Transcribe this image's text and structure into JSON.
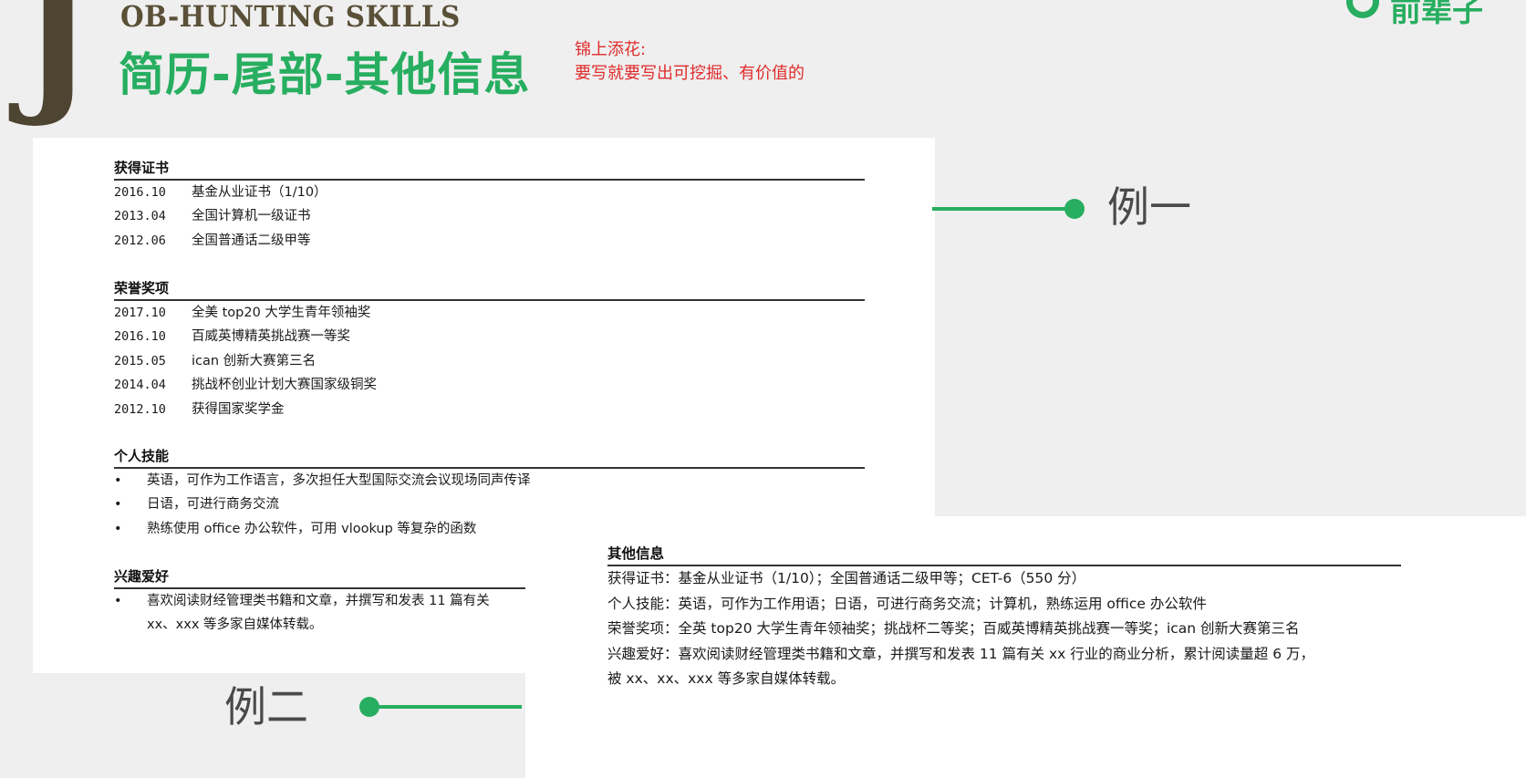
{
  "header": {
    "big_letter": "J",
    "subtitle_en": "OB-HUNTING SKILLS",
    "title_cn": "简历-尾部-其他信息",
    "logo_text": "前辈子"
  },
  "note": {
    "line1": "锦上添花:",
    "line2": "要写就要写出可挖掘、有价值的"
  },
  "example1": {
    "label": "例一",
    "sections": {
      "certs": {
        "title": "获得证书",
        "rows": [
          {
            "date": "2016.10",
            "text": "基金从业证书（1/10）"
          },
          {
            "date": "2013.04",
            "text": "全国计算机一级证书"
          },
          {
            "date": "2012.06",
            "text": "全国普通话二级甲等"
          }
        ]
      },
      "honors": {
        "title": "荣誉奖项",
        "rows": [
          {
            "date": "2017.10",
            "text": "全美 top20 大学生青年领袖奖"
          },
          {
            "date": "2016.10",
            "text": "百威英博精英挑战赛一等奖"
          },
          {
            "date": "2015.05",
            "text": "ican 创新大赛第三名"
          },
          {
            "date": "2014.04",
            "text": "挑战杯创业计划大赛国家级铜奖"
          },
          {
            "date": "2012.10",
            "text": "获得国家奖学金"
          }
        ]
      },
      "skills": {
        "title": "个人技能",
        "bullet": "•",
        "items": [
          "英语，可作为工作语言，多次担任大型国际交流会议现场同声传译",
          "日语，可进行商务交流",
          "熟练使用 office 办公软件，可用 vlookup 等复杂的函数"
        ]
      },
      "hobbies": {
        "title": "兴趣爱好",
        "bullet": "•",
        "line1": "喜欢阅读财经管理类书籍和文章，并撰写和发表 11 篇有关",
        "line2": "xx、xxx 等多家自媒体转载。"
      }
    }
  },
  "example2": {
    "label": "例二",
    "title": "其他信息",
    "rows": [
      "获得证书：基金从业证书（1/10）；全国普通话二级甲等；CET-6（550 分）",
      "个人技能：英语，可作为工作用语；日语，可进行商务交流；计算机，熟练运用 office 办公软件",
      "荣誉奖项：全英 top20 大学生青年领袖奖；挑战杯二等奖；百威英博精英挑战赛一等奖；ican 创新大赛第三名",
      "兴趣爱好：喜欢阅读财经管理类书籍和文章，并撰写和发表 11 篇有关 xx 行业的商业分析，累计阅读量超 6 万，",
      "被 xx、xx、xxx 等多家自媒体转载。"
    ]
  },
  "colors": {
    "accent": "#27ae60",
    "note": "#e02b2b",
    "brown": "#4d4431"
  }
}
